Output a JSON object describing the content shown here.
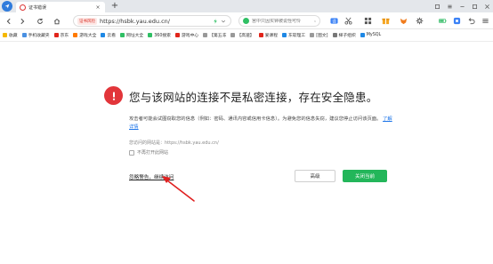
{
  "tab": {
    "title": "证书错误",
    "close": "×"
  },
  "toolbar": {
    "security_badge": "证书风险",
    "url": "https://hsbk.yau.edu.cn/",
    "search_placeholder": "宫中只因买钟被说怪可怜"
  },
  "bookmarks": [
    {
      "label": "收藏",
      "color": "#f5b800"
    },
    {
      "label": "手机收藏夹",
      "color": "#4a90e2"
    },
    {
      "label": "京东",
      "color": "#e1251b"
    },
    {
      "label": "游戏大全",
      "color": "#ff7a00"
    },
    {
      "label": "云看",
      "color": "#1e88e5"
    },
    {
      "label": "网址大全",
      "color": "#2fbf64"
    },
    {
      "label": "360搜索",
      "color": "#2fbf64"
    },
    {
      "label": "游戏中心",
      "color": "#e1251b"
    },
    {
      "label": "【第五冻",
      "color": "#999999"
    },
    {
      "label": "【高速】",
      "color": "#999999"
    },
    {
      "label": "爱课程",
      "color": "#e1251b"
    },
    {
      "label": "东软理工",
      "color": "#1e88e5"
    },
    {
      "label": "[图文]",
      "color": "#999999"
    },
    {
      "label": "梯子组织",
      "color": "#777777"
    },
    {
      "label": "MySQL",
      "color": "#1e88e5"
    }
  ],
  "error": {
    "heading": "您与该网站的连接不是私密连接，存在安全隐患。",
    "description": "攻击者可能会试图窃取您的信息（例如：密码、通讯内容或信用卡信息）。为避免您的信息失窃，建议您停止访问该页面。",
    "learn_more": "了解详情",
    "visit_url": "您访问的网站是：https://hsbk.yau.edu.cn/",
    "no_remind_label": "不再打开此网站",
    "ignore_link": "忽略警告，继续访问",
    "advanced_button": "高级",
    "close_button": "关闭当前"
  },
  "colors": {
    "error_red": "#e2353a",
    "primary_green": "#23b65a",
    "link_blue": "#1a73e8",
    "annotation_red": "#e02020"
  }
}
